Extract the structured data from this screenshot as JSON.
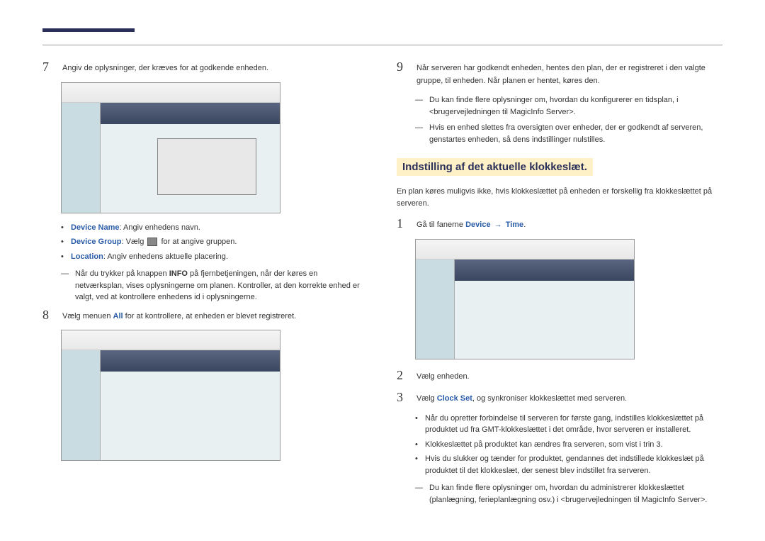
{
  "left": {
    "step7": {
      "num": "7",
      "text": "Angiv de oplysninger, der kræves for at godkende enheden."
    },
    "bullets": [
      {
        "label": "Device Name",
        "text": ": Angiv enhedens navn."
      },
      {
        "label": "Device Group",
        "text_before": ": Vælg ",
        "text_after": " for at angive gruppen."
      },
      {
        "label": "Location",
        "text": ": Angiv enhedens aktuelle placering."
      }
    ],
    "note7": {
      "dash": "―",
      "text_a": "Når du trykker på knappen ",
      "bold": "INFO",
      "text_b": " på fjernbetjeningen, når der køres en netværksplan, vises oplysningerne om planen. Kontroller, at den korrekte enhed er valgt, ved at kontrollere enhedens id i oplysningerne."
    },
    "step8": {
      "num": "8",
      "text_a": "Vælg menuen ",
      "bold": "All",
      "text_b": " for at kontrollere, at enheden er blevet registreret."
    }
  },
  "right": {
    "step9": {
      "num": "9",
      "text": "Når serveren har godkendt enheden, hentes den plan, der er registreret i den valgte gruppe, til enheden. Når planen er hentet, køres den."
    },
    "note9a": {
      "dash": "―",
      "text": "Du kan finde flere oplysninger om, hvordan du konfigurerer en tidsplan, i <brugervejledningen til MagicInfo Server>."
    },
    "note9b": {
      "dash": "―",
      "text": "Hvis en enhed slettes fra oversigten over enheder, der er godkendt af serveren, genstartes enheden, så dens indstillinger nulstilles."
    },
    "heading": "Indstilling af det aktuelle klokkeslæt.",
    "intro": "En plan køres muligvis ikke, hvis klokkeslættet på enheden er forskellig fra klokkeslættet på serveren.",
    "step1": {
      "num": "1",
      "text_a": "Gå til fanerne ",
      "blue_a": "Device",
      "arrow": " → ",
      "blue_b": "Time",
      "text_b": "."
    },
    "step2": {
      "num": "2",
      "text": "Vælg enheden."
    },
    "step3": {
      "num": "3",
      "text_a": "Vælg ",
      "blue": "Clock Set",
      "text_b": ", og synkroniser klokkeslættet med serveren."
    },
    "bullets3": [
      "Når du opretter forbindelse til serveren for første gang, indstilles klokkeslættet på produktet ud fra GMT-klokkeslættet i det område, hvor serveren er installeret.",
      "Klokkeslættet på produktet kan ændres fra serveren, som vist i trin 3.",
      "Hvis du slukker og tænder for produktet, gendannes det indstillede klokkeslæt på produktet til det klokkeslæt, der senest blev indstillet fra serveren."
    ],
    "note_end": {
      "dash": "―",
      "text": "Du kan finde flere oplysninger om, hvordan du administrerer klokkeslættet (planlægning, ferieplanlægning osv.) i <brugervejledningen til MagicInfo Server>."
    }
  }
}
